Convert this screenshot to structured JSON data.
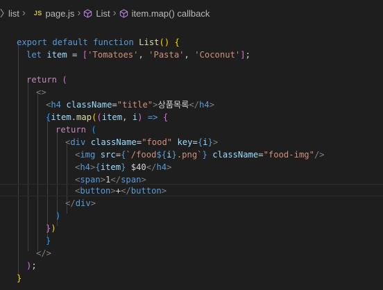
{
  "breadcrumb": {
    "folder": "list",
    "file_badge": "JS",
    "file": "page.js",
    "symbol1": "List",
    "symbol2": "item.map() callback"
  },
  "code": {
    "l1": {
      "export": "export",
      "default": "default",
      "function": "function",
      "name": "List",
      "parens": "()",
      "brace": "{"
    },
    "l2": {
      "let": "let",
      "var": "item",
      "eq": " = ",
      "open": "[",
      "s1": "'Tomatoes'",
      "c1": ", ",
      "s2": "'Pasta'",
      "c2": ", ",
      "s3": "'Coconut'",
      "close": "]",
      "semi": ";"
    },
    "l3": {
      "return": "return",
      "paren": "("
    },
    "l4": {
      "frag": "<>"
    },
    "l5": {
      "lt": "<",
      "tag": "h4",
      "attr": "className",
      "eq": "=",
      "val": "\"title\"",
      "gt": ">",
      "text": "상품목록",
      "close_lt": "</",
      "close_tag": "h4",
      "close_gt": ">"
    },
    "l6": {
      "brace": "{",
      "obj": "item",
      "dot": ".",
      "method": "map",
      "p1": "(",
      "p2": "(",
      "a1": "item",
      "comma": ", ",
      "a2": "i",
      "p3": ")",
      "arrow": " => ",
      "b": "{"
    },
    "l7": {
      "return": "return",
      "paren": "("
    },
    "l8": {
      "lt": "<",
      "tag": "div",
      "attr1": "className",
      "eq1": "=",
      "val1": "\"food\"",
      "attr2": "key",
      "eq2": "=",
      "b1": "{",
      "v2": "i",
      "b2": "}",
      "gt": ">"
    },
    "l9": {
      "lt": "<",
      "tag": "img",
      "attr1": "src",
      "eq1": "=",
      "b1": "{",
      "tpl1": "`/food",
      "interp_open": "${",
      "interp_var": "i",
      "interp_close": "}",
      "tpl2": ".png`",
      "b2": "}",
      "attr2": "className",
      "eq2": "=",
      "val2": "\"food-img\"",
      "gt": "/>"
    },
    "l10": {
      "lt": "<",
      "tag": "h4",
      "gt": ">",
      "b1": "{",
      "var": "item",
      "b2": "}",
      "text": " $40",
      "close_lt": "</",
      "close_tag": "h4",
      "close_gt": ">"
    },
    "l11": {
      "lt": "<",
      "tag": "span",
      "gt": ">",
      "text": "1",
      "close_lt": "</",
      "close_tag": "span",
      "close_gt": ">"
    },
    "l12": {
      "lt": "<",
      "tag": "button",
      "gt": ">",
      "text": "+",
      "close_lt": "</",
      "close_tag": "button",
      "close_gt": ">"
    },
    "l13": {
      "lt": "</",
      "tag": "div",
      "gt": ">"
    },
    "l14": {
      "paren": ")"
    },
    "l15": {
      "brace": "}",
      "paren": ")"
    },
    "l16": {
      "brace": "}"
    },
    "l17": {
      "frag": "</>"
    },
    "l18": {
      "paren": ")",
      "semi": ";"
    },
    "l19": {
      "brace": "}"
    }
  },
  "colors": {
    "background": "#1e1e1e",
    "keyword": "#569cd6",
    "control": "#c586c0",
    "function": "#dcdcaa",
    "variable": "#9cdcfe",
    "string": "#ce9178",
    "bracket1": "#ffd700",
    "bracket2": "#da70d6",
    "bracket3": "#179fff"
  },
  "icons": [
    "chevron-right-icon",
    "cube-icon"
  ]
}
